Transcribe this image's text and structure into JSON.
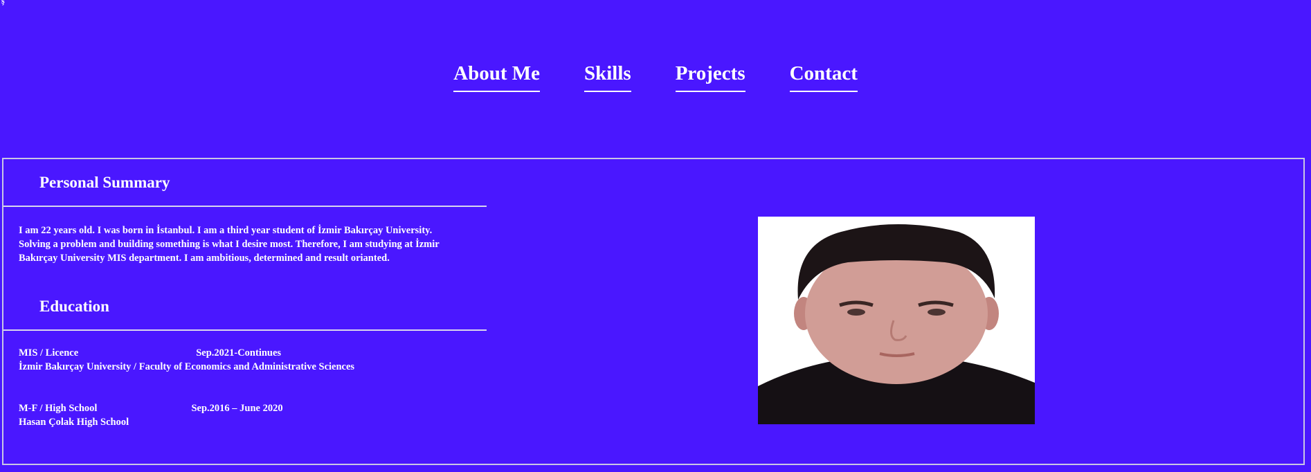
{
  "corner_mark": "ş",
  "nav": {
    "items": [
      "About Me",
      "Skills",
      "Projects",
      "Contact"
    ]
  },
  "summary": {
    "title": "Personal Summary",
    "text": "I am 22 years old. I was born in İstanbul. I am a third year student of İzmir Bakırçay University.\nSolving a problem and building something is what I desire most. Therefore, I am studying at İzmir\n Bakırçay University MIS department. I am ambitious, determined and result orianted."
  },
  "education": {
    "title": "Education",
    "entries": [
      {
        "degree": "MIS / Licence",
        "date": "Sep.2021-Continues",
        "school": "İzmir Bakırçay University / Faculty of Economics and Administrative Sciences"
      },
      {
        "degree": "M-F / High School",
        "date": "Sep.2016 – June 2020",
        "school": "Hasan Çolak High School"
      }
    ]
  },
  "colors": {
    "background": "#4a17ff",
    "text": "#ffffff",
    "panel_border": "#c9c6e4"
  }
}
